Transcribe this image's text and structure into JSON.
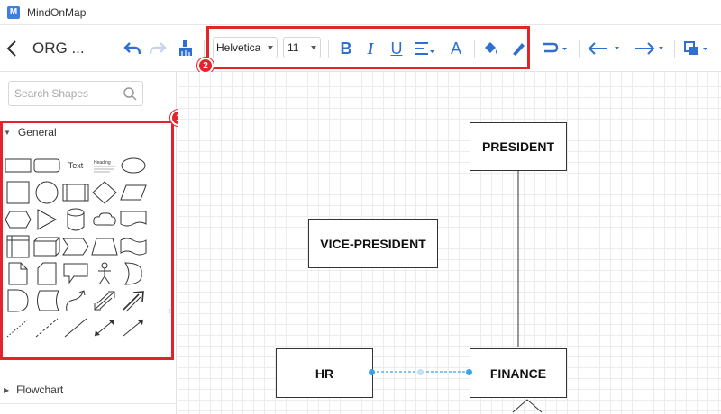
{
  "app": {
    "logo_letter": "M",
    "title": "MindOnMap"
  },
  "toolbar": {
    "doc_title": "ORG ...",
    "font_family": "Helvetica",
    "font_size": "11",
    "bold": "B",
    "italic": "I",
    "underline": "U",
    "font_color": "A"
  },
  "annotations": {
    "badge_1": "1",
    "badge_2": "2"
  },
  "sidebar": {
    "search_placeholder": "Search Shapes",
    "sections": {
      "general": "General",
      "flowchart": "Flowchart"
    },
    "text_shape_label": "Text",
    "heading_shape_label": "Heading"
  },
  "canvas": {
    "nodes": {
      "president": "PRESIDENT",
      "vice_president": "VICE-PRESIDENT",
      "hr": "HR",
      "finance": "FINANCE"
    }
  },
  "colors": {
    "accent": "#2f6fd0",
    "annotation_red": "#e3242b",
    "connector_blue": "#3aa3e8"
  }
}
